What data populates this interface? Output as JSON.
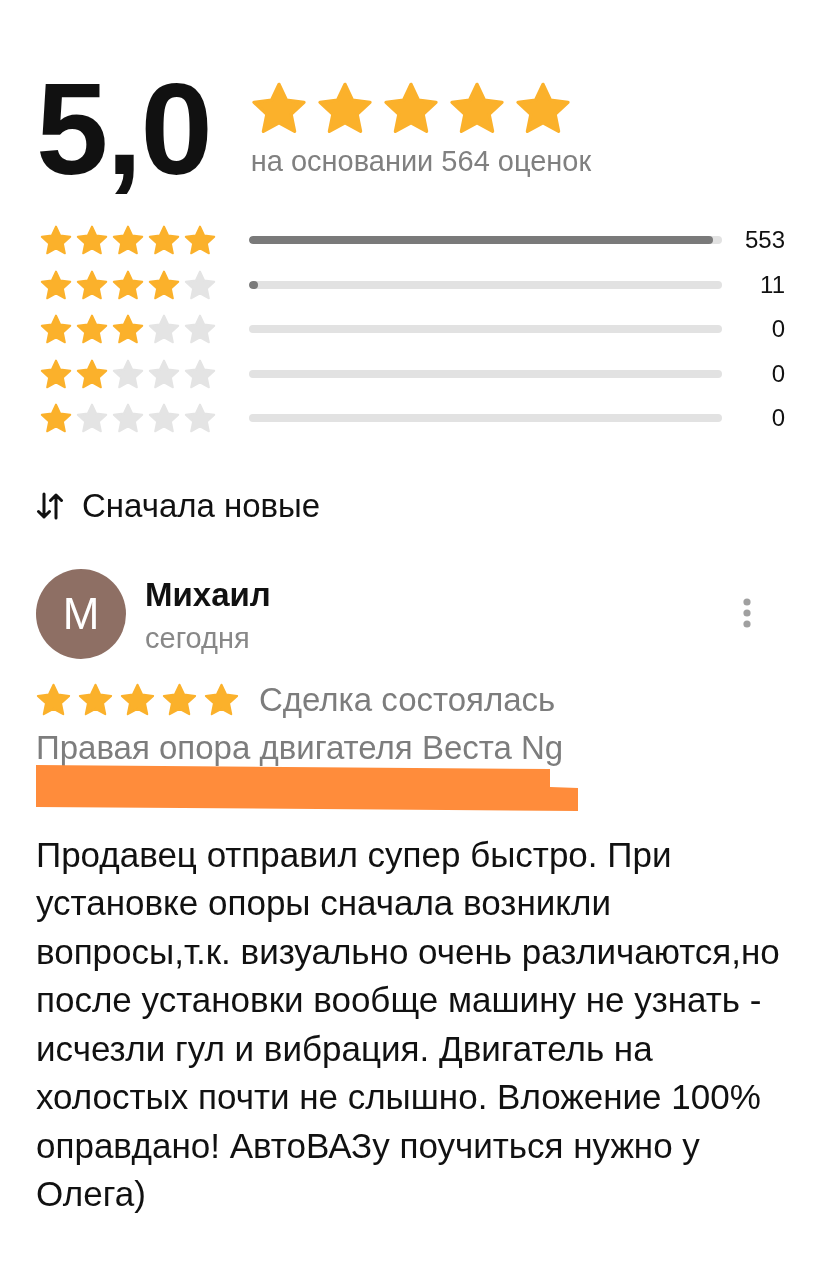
{
  "summary": {
    "score": "5,0",
    "stars": 5,
    "caption": "на основании 564 оценок"
  },
  "distribution": [
    {
      "stars": 5,
      "level": 0.98,
      "count": "553"
    },
    {
      "stars": 4,
      "level": 0.02,
      "count": "11"
    },
    {
      "stars": 3,
      "count": "0"
    },
    {
      "stars": 2,
      "count": "0"
    },
    {
      "stars": 1,
      "count": "0"
    }
  ],
  "sort": {
    "label": "Сначала новые"
  },
  "review": {
    "avatar_letter": "М",
    "author": "Михаил",
    "date": "сегодня",
    "stars": 5,
    "status": "Сделка состоялась",
    "product": "Правая опора двигателя Веста Ng",
    "redacted": true,
    "text": "Продавец отправил супер быстро. При установке опоры сначала возникли вопросы,т.к. визуально очень различаются,но после установки вообще машину не узнать - исчезли гул и вибрация. Двигатель на холостых почти не слышно. Вложение 100% оправдано! АвтоВАЗу поучиться нужно у Олега)"
  }
}
